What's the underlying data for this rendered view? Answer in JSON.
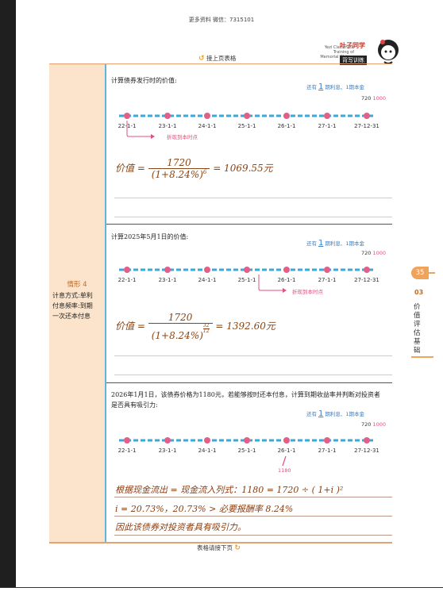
{
  "header_note": "更多资料 微信：7315101",
  "brand": {
    "line1": "Yezi Classmate",
    "line2": "Training of",
    "line3": "Memorial Writing",
    "logo_top": "叶子同学",
    "logo_bottom": "背写训练"
  },
  "continue_top": "接上页表格",
  "continue_bottom": "表格请接下页",
  "case": {
    "title": "情形 4",
    "lines": [
      "计息方式:单利",
      "付息频率:到期",
      "一次还本付息"
    ]
  },
  "side": {
    "page": "35",
    "chapter_num": "03",
    "chapter_title": "价值评估基础"
  },
  "legend": {
    "prefix": "还有",
    "n": "1",
    "suffix": "期利息、1期本金"
  },
  "cashflow_label": {
    "interest": "720",
    "principal": "1000"
  },
  "timeline_dates": [
    "22-1-1",
    "23-1-1",
    "24-1-1",
    "25-1-1",
    "26-1-1",
    "27-1-1",
    "27-12-31"
  ],
  "discount_label": "折现到本时点",
  "sections": [
    {
      "question": "计算债券发行时的价值:",
      "formula_label": "价值 =",
      "numerator": "1720",
      "denominator": "(1+8.24%)",
      "exponent": "6",
      "result": "= 1069.55元"
    },
    {
      "question": "计算2025年5月1日的价值:",
      "formula_label": "价值 =",
      "numerator": "1720",
      "denominator": "(1+8.24%)",
      "exponent_num": "32",
      "exponent_den": "12",
      "result": "= 1392.60元"
    },
    {
      "question_line1": "2026年1月1日，该债券价格为1180元，若能够按时还本付息，计算到期收益率并判断对投资者",
      "question_line2": "是否具有吸引力:",
      "price_label": "1180",
      "hw1": "根据现金流出 = 现金流入列式：1180 = 1720 ÷ ( 1+i )²",
      "hw2": "i = 20.73%，20.73% > 必要报酬率 8.24%",
      "hw3": "因此该债券对投资者具有吸引力。"
    }
  ]
}
